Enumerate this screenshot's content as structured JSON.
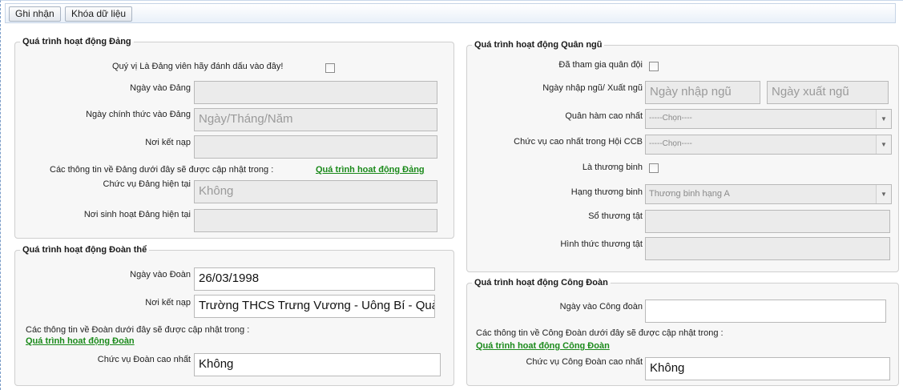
{
  "toolbar": {
    "save_label": "Ghi nhận",
    "lock_label": "Khóa dữ liệu"
  },
  "party": {
    "legend": "Quá trình hoạt động Đảng",
    "member_prompt": "Quý vị Là Đảng viên hãy đánh dấu vào đây!",
    "join_date_label": "Ngày vào Đảng",
    "join_date_value": "",
    "official_date_label": "Ngày chính thức vào Đảng",
    "official_date_placeholder": "Ngày/Tháng/Năm",
    "admission_place_label": "Nơi kết nạp",
    "admission_place_value": "",
    "update_note": "Các thông tin về Đảng dưới đây sẽ được cập nhật trong :",
    "update_link": "Quá trình hoat động Đảng",
    "current_position_label": "Chức vụ Đảng hiện tại",
    "current_position_value": "Không",
    "current_activity_place_label": "Nơi sinh hoạt Đảng hiện tại",
    "current_activity_place_value": ""
  },
  "union": {
    "legend": "Quá trình hoạt động Đoàn thể",
    "join_date_label": "Ngày vào Đoàn",
    "join_date_value": "26/03/1998",
    "admission_place_label": "Nơi kết nạp",
    "admission_place_value": "Trường THCS Trưng Vương - Uông Bí - Quả",
    "update_note": "Các thông tin về Đoàn dưới đây sẽ được cập nhật trong :",
    "update_link": "Quá trình hoat động Đoàn",
    "highest_position_label": "Chức vụ Đoàn cao nhất",
    "highest_position_value": "Không"
  },
  "military": {
    "legend": "Quá trình hoạt động Quân ngũ",
    "served_label": "Đã tham gia quân đội",
    "enlist_label": "Ngày nhập ngũ/ Xuất ngũ",
    "enlist_placeholder": "Ngày nhập ngũ",
    "discharge_placeholder": "Ngày xuất ngũ",
    "rank_label": "Quân hàm cao nhất",
    "rank_value": "-----Chọn----",
    "veteran_position_label": "Chức vụ cao nhất trong Hội CCB",
    "veteran_position_value": "-----Chọn----",
    "wounded_label": "Là thương binh",
    "wounded_class_label": "Hạng thương binh",
    "wounded_class_value": "Thương binh hạng A",
    "injury_book_label": "Sổ thương tật",
    "injury_book_value": "",
    "injury_form_label": "Hình thức thương tật",
    "injury_form_value": ""
  },
  "trade_union": {
    "legend": "Quá trình hoạt động Công Đoàn",
    "join_date_label": "Ngày vào Công đoàn",
    "join_date_value": "",
    "update_note": "Các thông tin về Công Đoàn dưới đây sẽ được cập nhật trong :",
    "update_link": "Quá trình hoat động Công Đoàn",
    "highest_position_label": "Chức vụ Công Đoàn cao nhất",
    "highest_position_value": "Không"
  }
}
